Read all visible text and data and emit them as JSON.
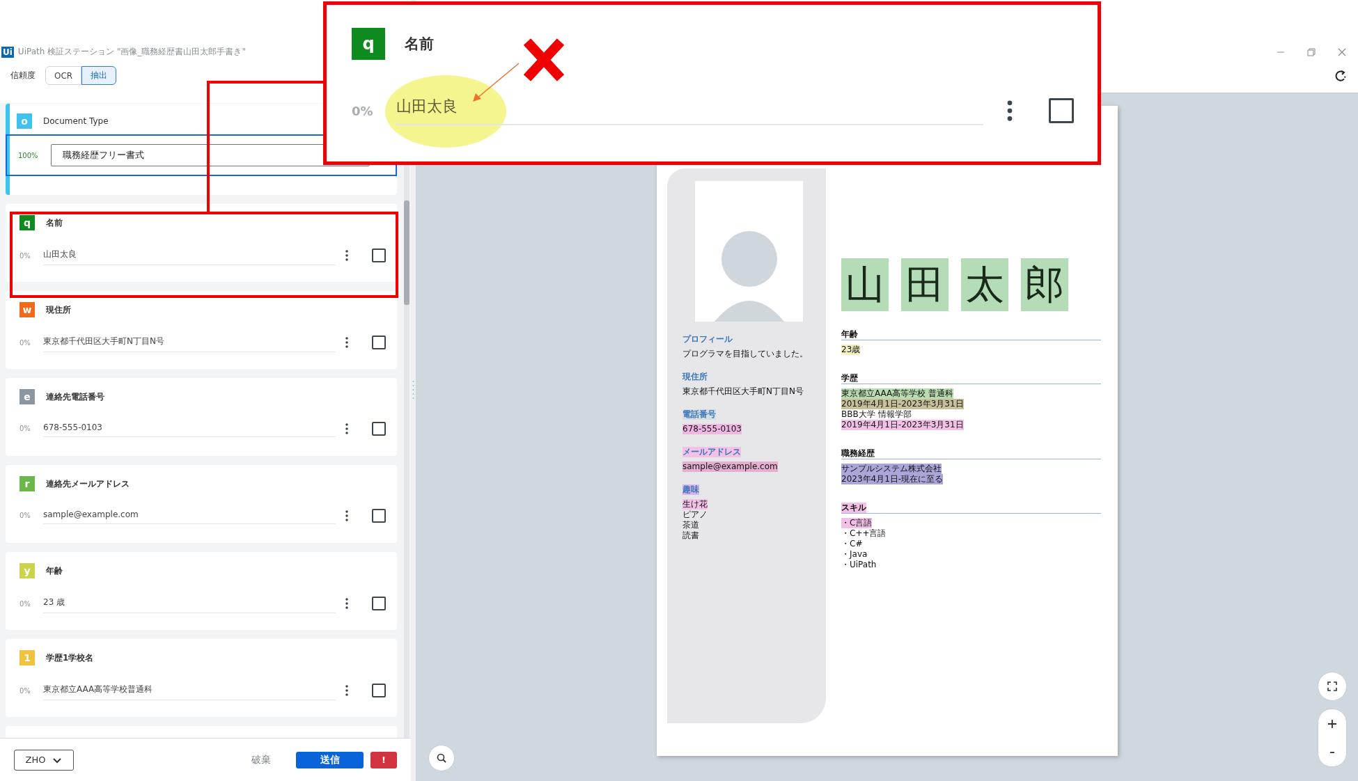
{
  "window": {
    "app_icon": "Ui",
    "title": "UiPath 検証ステーション \"画像_職務経歴書山田太郎手書き\""
  },
  "toolbar": {
    "label": "信頼度",
    "modes": [
      {
        "label": "OCR",
        "selected": false
      },
      {
        "label": "抽出",
        "selected": true
      }
    ]
  },
  "document_type": {
    "badge": "o",
    "color": "#3ec3ee",
    "label": "Document Type",
    "confidence": "100%",
    "value": "職務経歴フリー書式"
  },
  "fields": [
    {
      "badge": "q",
      "color": "#0f8a1e",
      "label": "名前",
      "confidence": "0%",
      "value": "山田太良",
      "checked": false
    },
    {
      "badge": "w",
      "color": "#f2691c",
      "label": "現住所",
      "confidence": "0%",
      "value": "東京都千代田区大手町N丁目N号",
      "checked": false
    },
    {
      "badge": "e",
      "color": "#8a96a1",
      "label": "連絡先電話番号",
      "confidence": "0%",
      "value": "678-555-0103",
      "checked": false
    },
    {
      "badge": "r",
      "color": "#6bb74b",
      "label": "連絡先メールアドレス",
      "confidence": "0%",
      "value": "sample@example.com",
      "checked": false
    },
    {
      "badge": "y",
      "color": "#cdd24c",
      "label": "年齢",
      "confidence": "0%",
      "value": "23 歳",
      "checked": false
    },
    {
      "badge": "1",
      "color": "#f2c13d",
      "label": "学歴1学校名",
      "confidence": "0%",
      "value": "東京都立AAA高等学校普通科",
      "checked": false
    }
  ],
  "footer": {
    "language": "ZHO",
    "discard": "破棄",
    "submit": "送信",
    "alert": "!"
  },
  "document": {
    "name": [
      {
        "text": "山",
        "color": "#b3dcb7"
      },
      {
        "text": "田",
        "color": "#b3dcb7"
      },
      {
        "text": "太",
        "color": "#b3dcb7"
      },
      {
        "text": "郎",
        "color": "#b3dcb7"
      }
    ],
    "sidebar": [
      {
        "heading": {
          "text": "プロフィール"
        },
        "lines": [
          {
            "text": "プログラマを目指していました。"
          }
        ]
      },
      {
        "heading": {
          "text": "現住所"
        },
        "lines": [
          {
            "text": "東京都千代田区大手町N丁目N号"
          }
        ]
      },
      {
        "heading": {
          "text": "電話番号",
          "color": "#d5dde3"
        },
        "lines": [
          {
            "text": "678-555-0103",
            "color": "#f0b6e2"
          }
        ]
      },
      {
        "heading": {
          "text": "メールアドレス",
          "color": "#f3c0e8"
        },
        "lines": [
          {
            "text": "sample@example.com",
            "color": "#e5b0cf"
          }
        ]
      },
      {
        "heading": {
          "text": "趣味",
          "color": "#dcb2ea"
        },
        "lines": [
          {
            "text": "生け花",
            "color": "#f3c0e8"
          },
          {
            "text": "ピアノ"
          },
          {
            "text": "茶道"
          },
          {
            "text": "読書"
          }
        ]
      }
    ],
    "sections": [
      {
        "heading": {
          "text": "年齢"
        },
        "lines": [
          {
            "text": "23歳",
            "color": "#f3f0c2"
          }
        ]
      },
      {
        "heading": {
          "text": "学歴"
        },
        "lines": [
          {
            "text": "東京都立AAA高等学校 普通科",
            "color": "#b9dcb0"
          },
          {
            "text": "2019年4月1日-2023年3月31日",
            "color": "#c8c09a"
          },
          {
            "text": "BBB大学 情報学部"
          },
          {
            "text": "2019年4月1日-2023年3月31日",
            "color": "#f3c0e8"
          }
        ]
      },
      {
        "heading": {
          "text": "職務経歴"
        },
        "lines": [
          {
            "text": "サンプルシステム株式会社",
            "color": "#a9a6d8"
          },
          {
            "text": "2023年4月1日-現在に至る",
            "color": "#a9a6d8"
          }
        ]
      },
      {
        "heading": {
          "text": "スキル",
          "color": "#f3c0e8"
        },
        "lines": [
          {
            "text": "・C言語",
            "color": "#f3c0e8"
          },
          {
            "text": "・C++言語"
          },
          {
            "text": "・C#"
          },
          {
            "text": "・Java"
          },
          {
            "text": "・UiPath"
          }
        ]
      }
    ]
  },
  "callout": {
    "badge": "q",
    "color": "#0f8a1e",
    "label": "名前",
    "confidence": "0%",
    "value": "山田太良",
    "checked": false
  }
}
